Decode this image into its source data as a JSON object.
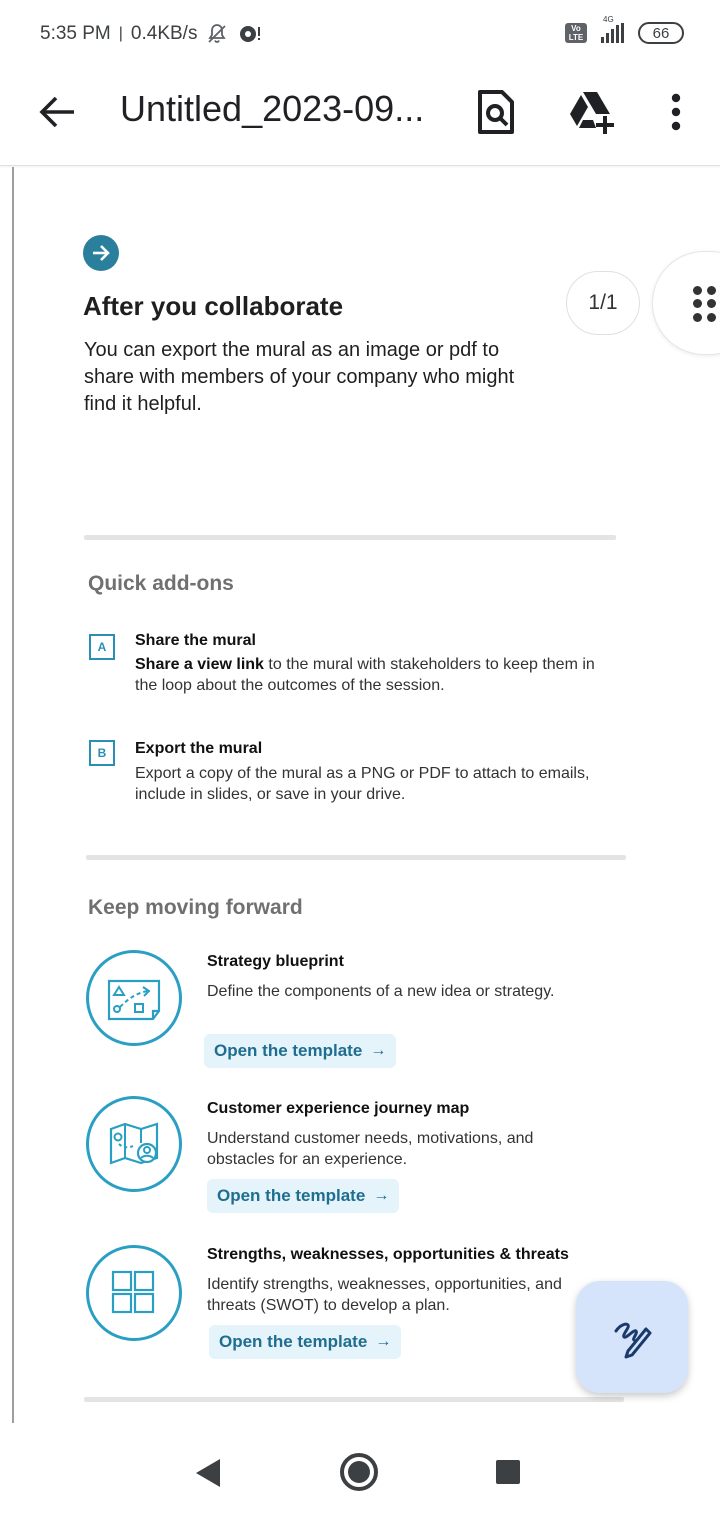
{
  "status_bar": {
    "time": "5:35 PM",
    "separator": "|",
    "net_speed": "0.4KB/s",
    "volte": "Vo LTE",
    "network": "4G",
    "battery": "66"
  },
  "app_bar": {
    "title": "Untitled_2023-09...",
    "icons": [
      "back-arrow-icon",
      "find-in-page-icon",
      "add-to-drive-icon",
      "more-vert-icon"
    ]
  },
  "mural": {
    "heading": "After you collaborate",
    "lead": "You can export the mural as an image or pdf to share with members of your company who might find it helpful.",
    "page_indicator": "1/1",
    "quick_addons": {
      "title": "Quick add-ons",
      "items": [
        {
          "badge": "A",
          "title": "Share the mural",
          "desc_bold": "Share a view link",
          "desc": " to the mural with stakeholders to keep them in the loop about the outcomes of the session."
        },
        {
          "badge": "B",
          "title": "Export the mural",
          "desc": "Export a copy of the mural as a PNG or PDF to attach to emails, include in slides, or save in your drive."
        }
      ]
    },
    "keep_moving": {
      "title": "Keep moving forward",
      "templates": [
        {
          "icon": "strategy-blueprint-icon",
          "title": "Strategy blueprint",
          "desc": "Define the components of a new idea or strategy.",
          "button": "Open the template"
        },
        {
          "icon": "journey-map-icon",
          "title": "Customer experience journey map",
          "desc": "Understand customer needs, motivations, and obstacles for an experience.",
          "button": "Open the template"
        },
        {
          "icon": "swot-grid-icon",
          "title": "Strengths, weaknesses, opportunities & threats",
          "desc": "Identify strengths, weaknesses, opportunities, and threats (SWOT) to develop a plan.",
          "button": "Open the template"
        }
      ]
    }
  },
  "colors": {
    "accent": "#2a7f9d",
    "icon_stroke": "#2a9fc4",
    "button_bg": "#e5f3fb",
    "button_text": "#1f6d8f",
    "fab_bg": "#d6e4fb",
    "fab_icon": "#1a3a6b"
  }
}
